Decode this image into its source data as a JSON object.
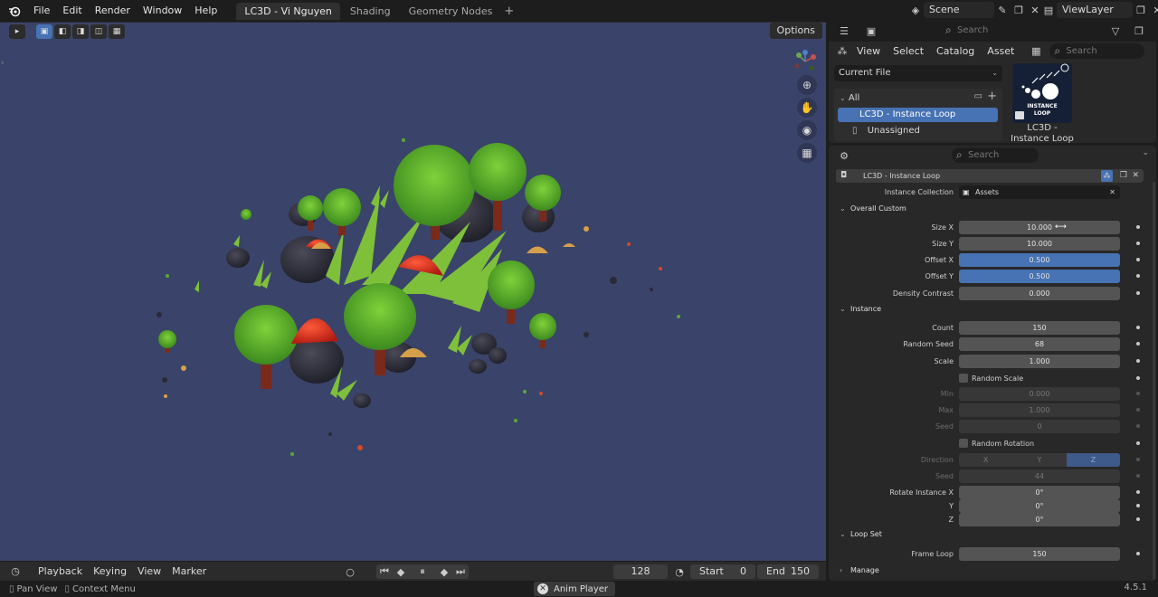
{
  "topbar": {
    "menus": [
      "File",
      "Edit",
      "Render",
      "Window",
      "Help"
    ],
    "workspaces": [
      {
        "label": "LC3D - Vi Nguyen",
        "active": true
      },
      {
        "label": "Shading",
        "active": false
      },
      {
        "label": "Geometry Nodes",
        "active": false
      }
    ],
    "scene": "Scene",
    "view_layer": "ViewLayer"
  },
  "viewport": {
    "options_label": "Options",
    "background_color": "#3a4369"
  },
  "outliner": {
    "search_placeholder": "Search"
  },
  "asset_browser": {
    "menus": [
      "View",
      "Select",
      "Catalog",
      "Asset"
    ],
    "search_placeholder": "Search",
    "library": "Current File",
    "catalog_all": "All",
    "catalog_selected": "LC3D - Instance Loop",
    "catalog_unassigned": "Unassigned",
    "asset_name_line1": "LC3D -",
    "asset_name_line2": "Instance Loop",
    "thumb_text_line1": "INSTANCE",
    "thumb_text_line2": "LOOP"
  },
  "properties": {
    "search_placeholder": "Search",
    "modifier_name": "LC3D - Instance Loop",
    "instance_collection_label": "Instance Collection",
    "instance_collection_value": "Assets",
    "sections": {
      "overall": "Overall Custom",
      "instance": "Instance",
      "loop_set": "Loop Set",
      "manage": "Manage"
    },
    "overall": [
      {
        "label": "Size X",
        "value": "10.000"
      },
      {
        "label": "Size Y",
        "value": "10.000"
      },
      {
        "label": "Offset X",
        "value": "0.500"
      },
      {
        "label": "Offset Y",
        "value": "0.500"
      },
      {
        "label": "Density Contrast",
        "value": "0.000"
      }
    ],
    "instance": [
      {
        "label": "Count",
        "value": "150"
      },
      {
        "label": "Random Seed",
        "value": "68"
      },
      {
        "label": "Scale",
        "value": "1.000"
      }
    ],
    "random_scale_label": "Random Scale",
    "random_scale_fields": [
      {
        "label": "Min",
        "value": "0.000"
      },
      {
        "label": "Max",
        "value": "1.000"
      },
      {
        "label": "Seed",
        "value": "0"
      }
    ],
    "random_rotation_label": "Random Rotation",
    "direction_label": "Direction",
    "direction_options": [
      "X",
      "Y",
      "Z"
    ],
    "direction_selected": "Z",
    "rotation_seed": {
      "label": "Seed",
      "value": "44"
    },
    "rotate_instance": [
      {
        "label": "Rotate Instance X",
        "value": "0°"
      },
      {
        "label": "Y",
        "value": "0°"
      },
      {
        "label": "Z",
        "value": "0°"
      }
    ],
    "frame_loop": {
      "label": "Frame Loop",
      "value": "150"
    }
  },
  "timeline": {
    "menus": [
      "Playback",
      "Keying",
      "View",
      "Marker"
    ],
    "current_frame": "128",
    "start_label": "Start",
    "start_value": "0",
    "end_label": "End",
    "end_value": "150"
  },
  "statusbar": {
    "pan_view": "Pan View",
    "context_menu": "Context Menu",
    "anim_player": "Anim Player",
    "version": "4.5.1"
  }
}
